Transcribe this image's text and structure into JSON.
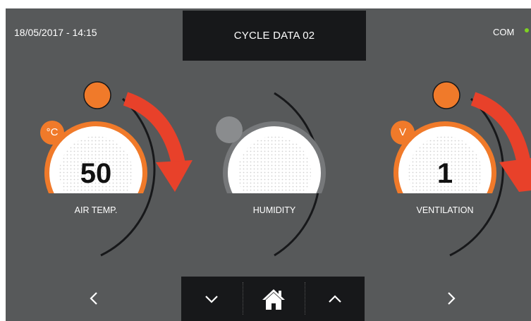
{
  "header": {
    "datetime": "18/05/2017 - 14:15",
    "title": "CYCLE DATA 02",
    "com_label": "COM",
    "com_status_color": "#7ed321"
  },
  "gauges": [
    {
      "label": "AIR TEMP.",
      "value": "50",
      "unit": "°C",
      "active": true
    },
    {
      "label": "HUMIDITY",
      "value": "",
      "unit": "",
      "active": false
    },
    {
      "label": "VENTILATION",
      "value": "1",
      "unit": "V",
      "active": true
    }
  ],
  "colors": {
    "background": "#57595a",
    "bar": "#17181a",
    "accent_orange": "#f07a2a",
    "arrow_red": "#e8412a",
    "inactive_knob": "#8a8c8e"
  },
  "nav": {
    "prev_icon": "chevron-left-icon",
    "next_icon": "chevron-right-icon",
    "down_icon": "chevron-down-icon",
    "home_icon": "home-icon",
    "up_icon": "chevron-up-icon"
  }
}
